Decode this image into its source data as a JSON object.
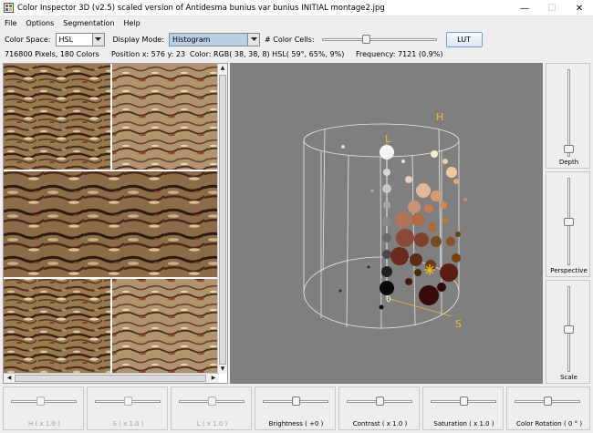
{
  "window": {
    "title": "Color Inspector 3D (v2.5)   scaled version of Antidesma bunius var bunius INITIAL montage2.jpg",
    "minimize": "—",
    "maximize": "☐",
    "close": "✕"
  },
  "menu": [
    "File",
    "Options",
    "Segmentation",
    "Help"
  ],
  "controls": {
    "color_space_label": "Color Space:",
    "color_space_value": "HSL",
    "display_mode_label": "Display Mode:",
    "display_mode_value": "Histogram",
    "color_cells_label": "# Color Cells:",
    "color_cells_slider": 0.38,
    "lut_button": "LUT"
  },
  "status": {
    "pixels": "716800 Pixels, 180 Colors",
    "position": "Position x: 576 y: 23",
    "color": "Color:  RGB(  38,  38,  8)  HSL(  59°,  65%,  9%)",
    "frequency": "Frequency: 7121 (0.9%)"
  },
  "view3d": {
    "label_h": "H",
    "label_l": "L",
    "label_s": "S",
    "label_zero": "0"
  },
  "right_sliders": [
    {
      "label": "Depth",
      "value": 0.95
    },
    {
      "label": "Perspective",
      "value": 0.5
    },
    {
      "label": "Scale",
      "value": 0.5
    }
  ],
  "bottom_sliders": [
    {
      "label": "H ( x 1.0 )",
      "enabled": false,
      "value": 0.45
    },
    {
      "label": "S ( x 1.0 )",
      "enabled": false,
      "value": 0.5
    },
    {
      "label": "L ( x 1.0 )",
      "enabled": false,
      "value": 0.5
    },
    {
      "label": "Brightness ( +0 )",
      "enabled": true,
      "value": 0.5
    },
    {
      "label": "Contrast ( x 1.0 )",
      "enabled": true,
      "value": 0.5
    },
    {
      "label": "Saturation ( x 1.0 )",
      "enabled": true,
      "value": 0.5
    },
    {
      "label": "Color Rotation ( 0 ° )",
      "enabled": true,
      "value": 0.5
    }
  ],
  "colors": {
    "view_bg": "#7f7f7f",
    "axis_label": "#f0c020",
    "selection_blue": "#b8cfe5"
  }
}
